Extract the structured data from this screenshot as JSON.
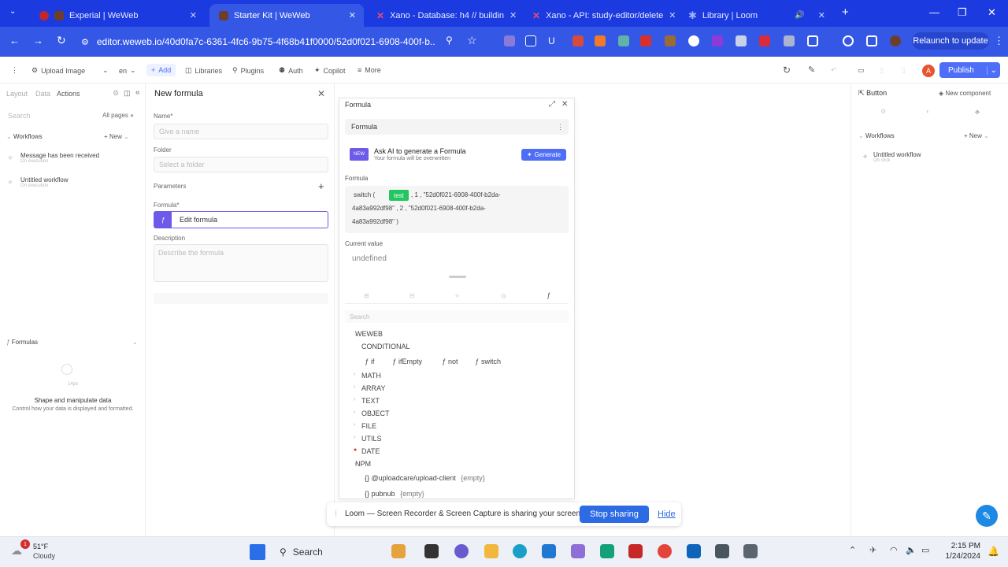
{
  "browser": {
    "tabs": [
      {
        "title": "Experial | WeWeb",
        "active": false
      },
      {
        "title": "Starter Kit | WeWeb",
        "active": true
      },
      {
        "title": "Xano - Database: h4 // buildin",
        "active": false
      },
      {
        "title": "Xano - API: study-editor/delete",
        "active": false
      },
      {
        "title": "Library | Loom",
        "active": false
      }
    ],
    "url": "editor.weweb.io/40d0fa7c-6361-4fc6-9b75-4f68b41f0000/52d0f021-6908-400f-b...",
    "relaunch_label": "Relaunch to update"
  },
  "toolbar": {
    "upload_image": "Upload Image",
    "lang": "en",
    "add": "Add",
    "libraries": "Libraries",
    "plugins": "Plugins",
    "auth": "Auth",
    "copilot": "Copilot",
    "more": "More",
    "publish": "Publish",
    "avatar_letter": "A"
  },
  "left_panel": {
    "tabs": [
      "Layout",
      "Data",
      "Actions"
    ],
    "search_placeholder": "Search",
    "pages_label": "All pages",
    "workflows_header": "Workflows",
    "new_label": "New",
    "workflows": [
      {
        "name": "Message has been received",
        "trigger": "On execution"
      },
      {
        "name": "Untitled workflow",
        "trigger": "On execution"
      }
    ],
    "formulas_header": "Formulas",
    "empty_title": "Shape and manipulate data",
    "empty_desc": "Control how your data is displayed and formatted.",
    "px_label": "14px"
  },
  "formula_panel": {
    "title": "New formula",
    "name_label": "Name",
    "name_placeholder": "Give a name",
    "folder_label": "Folder",
    "folder_placeholder": "Select a folder",
    "parameters_label": "Parameters",
    "formula_label": "Formula",
    "edit_formula": "Edit formula",
    "description_label": "Description",
    "description_placeholder": "Describe the formula"
  },
  "editor": {
    "header": "Formula",
    "select_label": "Formula",
    "new_badge": "NEW",
    "ai_title": "Ask AI to generate a Formula",
    "ai_sub": "Your formula will be overwritten",
    "generate": "Generate",
    "formula_label": "Formula",
    "code_prefix": "switch (",
    "code_var": "test",
    "code_line1": ", 1 , \"52d0f021-6908-400f-b2da-",
    "code_line2": "4a83a992df98\" , 2 , \"52d0f021-6908-400f-b2da-",
    "code_line3": "4a83a992df98\" )",
    "current_value_label": "Current value",
    "current_value": "undefined",
    "search_placeholder": "Search",
    "weweb_group": "WEWEB",
    "conditional": "CONDITIONAL",
    "functions": [
      "if",
      "ifEmpty",
      "not",
      "switch"
    ],
    "categories": [
      "MATH",
      "ARRAY",
      "TEXT",
      "OBJECT",
      "FILE",
      "UTILS",
      "DATE"
    ],
    "npm_group": "NPM",
    "npm_packages": [
      {
        "name": "@uploadcare/upload-client",
        "value": "{empty}"
      },
      {
        "name": "pubnub",
        "value": "{empty}"
      }
    ]
  },
  "right_panel": {
    "component": "Button",
    "new_component": "New component",
    "workflows_header": "Workflows",
    "new_label": "New",
    "workflow": "Untitled workflow",
    "workflow_trigger": "On click"
  },
  "loom": {
    "message": "Loom — Screen Recorder & Screen Capture is sharing your screen.",
    "stop": "Stop sharing",
    "hide": "Hide"
  },
  "taskbar": {
    "weather_temp": "51°F",
    "weather_desc": "Cloudy",
    "notif_count": "1",
    "search": "Search",
    "time": "2:15 PM",
    "date": "1/24/2024"
  },
  "colors": {
    "chrome_blue": "#1b3adf",
    "weweb_accent": "#4f6ef7",
    "chip_green": "#22c55e",
    "loom_stop": "#2d6be4"
  }
}
